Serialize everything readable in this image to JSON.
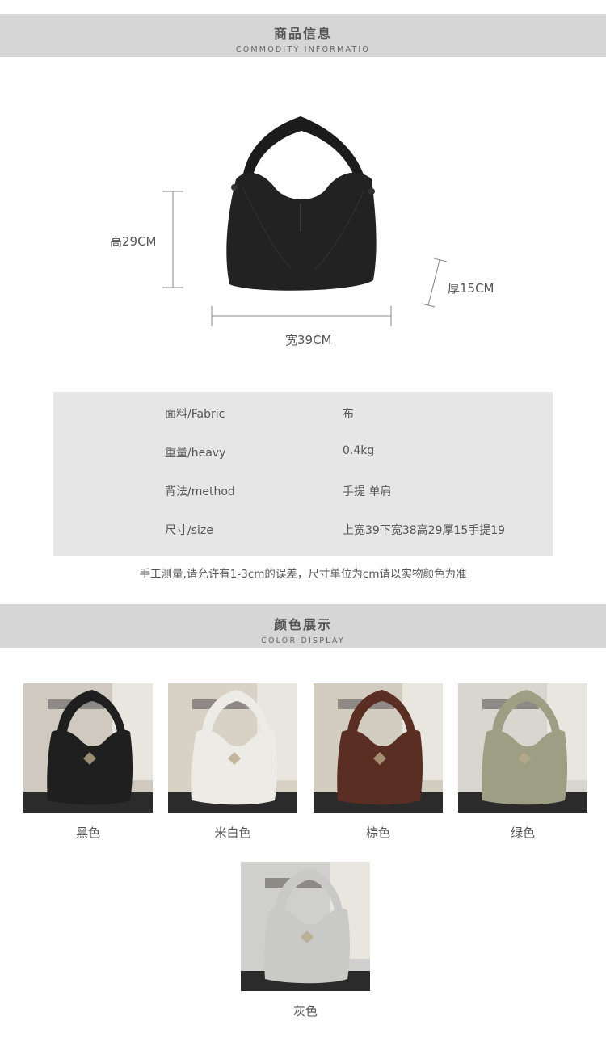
{
  "info_section": {
    "title": "商品信息",
    "subtitle": "COMMODITY INFORMATIO"
  },
  "dimensions": {
    "height": "高29CM",
    "width": "宽39CM",
    "depth": "厚15CM"
  },
  "specs": [
    {
      "label": "面料/Fabric",
      "value": "布"
    },
    {
      "label": "重量/heavy",
      "value": "0.4kg"
    },
    {
      "label": "背法/method",
      "value": "手提 单肩"
    },
    {
      "label": "尺寸/size",
      "value": "上宽39下宽38高29厚15手提19"
    }
  ],
  "note": "手工测量,请允许有1-3cm的误差，尺寸单位为cm请以实物颜色为准",
  "color_section": {
    "title": "颜色展示",
    "subtitle": "COLOR DISPLAY"
  },
  "colors": [
    {
      "name": "黑色",
      "bag_color": "#1f1f1f",
      "bg": "#cfc9bf"
    },
    {
      "name": "米白色",
      "bag_color": "#ecebe6",
      "bg": "#d7d1c6"
    },
    {
      "name": "棕色",
      "bag_color": "#5a2e22",
      "bg": "#d3ccc0"
    },
    {
      "name": "绿色",
      "bag_color": "#9c9f84",
      "bg": "#d9d6cf"
    },
    {
      "name": "灰色",
      "bag_color": "#c9c9c7",
      "bg": "#cfcfcd"
    }
  ]
}
